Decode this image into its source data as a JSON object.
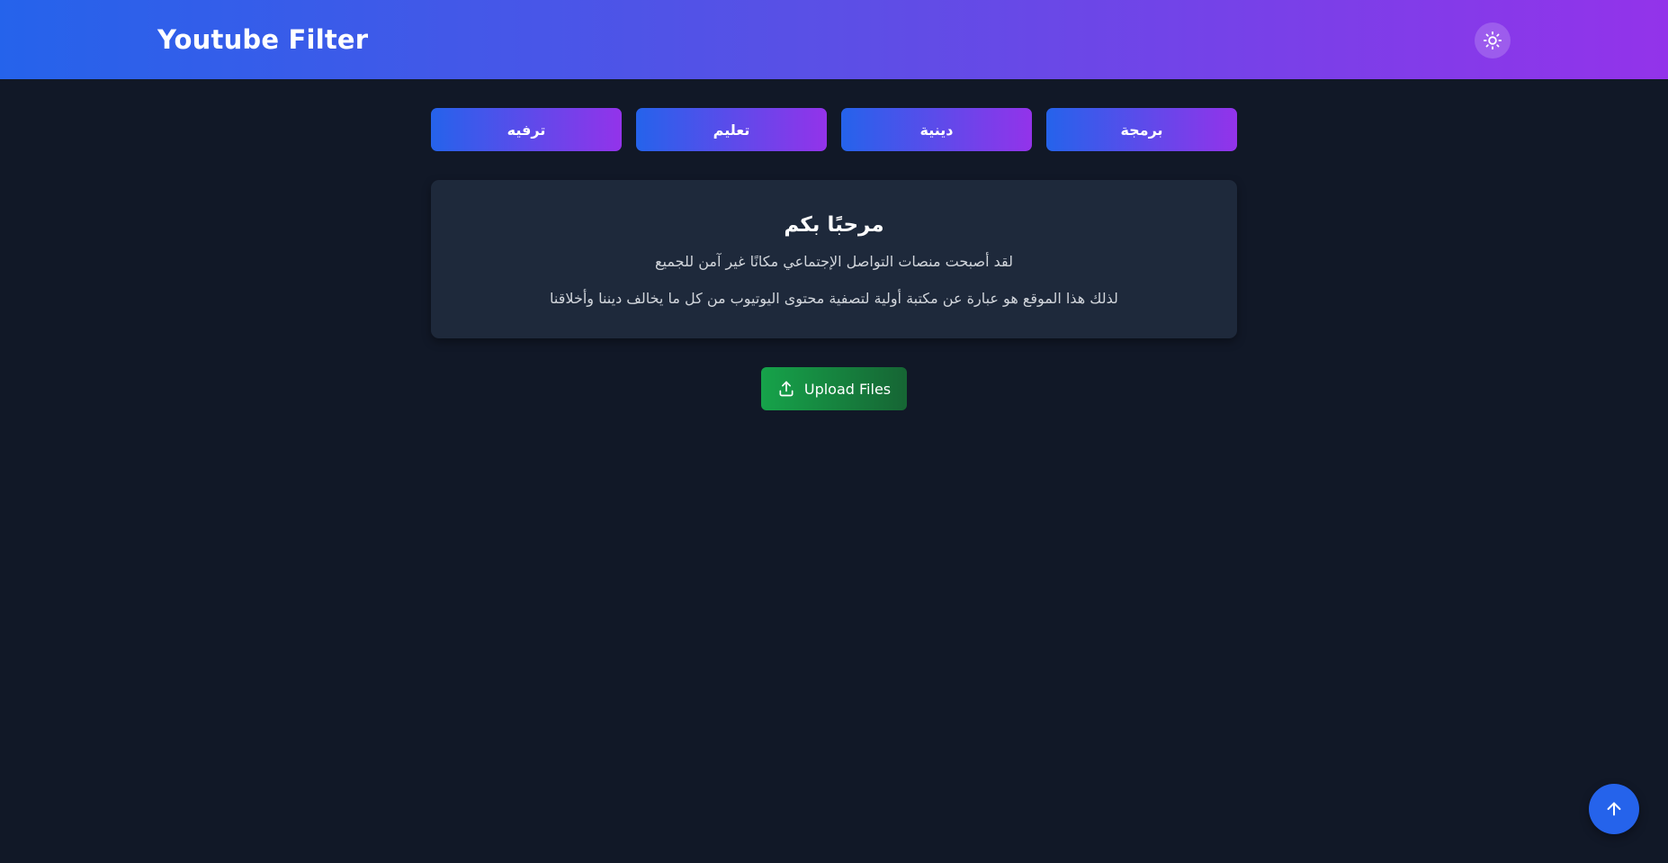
{
  "header": {
    "brand": "Youtube Filter",
    "theme_toggle_icon": "sun-icon"
  },
  "categories": [
    {
      "label": "برمجة"
    },
    {
      "label": "دينية"
    },
    {
      "label": "تعليم"
    },
    {
      "label": "ترفيه"
    }
  ],
  "welcome": {
    "title": "مرحبًا بكم",
    "line1": "لقد أصبحت منصات التواصل الإجتماعي مكانًا غير آمن للجميع",
    "line2": "لذلك هذا الموقع هو عبارة عن مكتبة أولية لتصفية محتوى اليوتيوب من كل ما يخالف ديننا وأخلاقنا"
  },
  "upload": {
    "label": "Upload Files",
    "icon": "upload-icon"
  },
  "scroll_top": {
    "icon": "arrow-up-icon"
  },
  "colors": {
    "background": "#111827",
    "card": "#1e293b",
    "accent_blue": "#2563eb",
    "accent_purple": "#9333ea",
    "upload_green": "#16a34a"
  }
}
